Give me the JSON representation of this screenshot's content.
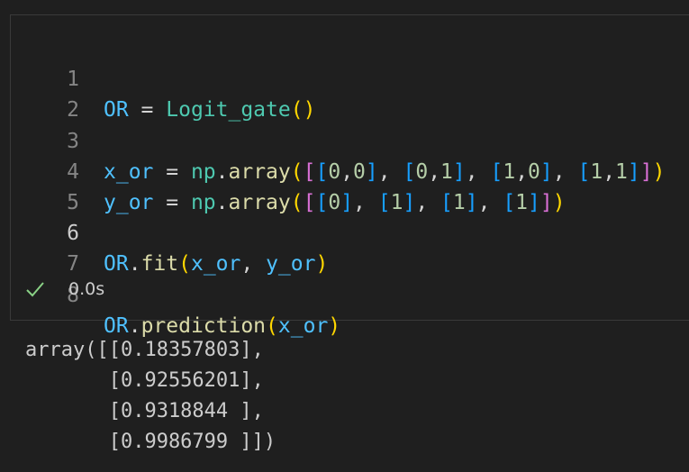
{
  "cell": {
    "lines": [
      {
        "number": "1",
        "tokens": [
          "OR",
          " = ",
          "Logit_gate",
          "(",
          ")"
        ]
      },
      {
        "number": "2",
        "tokens": []
      },
      {
        "number": "3",
        "tokens": [
          "x_or",
          " = ",
          "np",
          ".",
          "array",
          "(",
          "[",
          "[",
          "0",
          ",",
          "0",
          "]",
          ", ",
          "[",
          "0",
          ",",
          "1",
          "]",
          ", ",
          "[",
          "1",
          ",",
          "0",
          "]",
          ", ",
          "[",
          "1",
          ",",
          "1",
          "]",
          "]",
          ")"
        ]
      },
      {
        "number": "4",
        "tokens": [
          "y_or",
          " = ",
          "np",
          ".",
          "array",
          "(",
          "[",
          "[",
          "0",
          "]",
          ", ",
          "[",
          "1",
          "]",
          ", ",
          "[",
          "1",
          "]",
          ", ",
          "[",
          "1",
          "]",
          "]",
          ")"
        ]
      },
      {
        "number": "5",
        "tokens": []
      },
      {
        "number": "6",
        "tokens": [
          "OR",
          ".",
          "fit",
          "(",
          "x_or",
          ", ",
          "y_or",
          ")"
        ]
      },
      {
        "number": "7",
        "tokens": []
      },
      {
        "number": "8",
        "tokens": [
          "OR",
          ".",
          "prediction",
          "(",
          "x_or",
          ")"
        ]
      }
    ],
    "active_line": "6",
    "execution_time": "0.0s",
    "status_icon": "check-icon"
  },
  "output": {
    "lines": [
      "array([[0.18357803],",
      "       [0.92556201],",
      "       [0.9318844 ],",
      "       [0.9986799 ]])"
    ]
  },
  "colors": {
    "background": "#1f1f1f",
    "variable": "#4fc1ff",
    "function": "#dcdcaa",
    "class": "#4ec9b0",
    "number": "#b5cea8",
    "bracket_level_1": "#ffd700",
    "bracket_level_2": "#da70d6",
    "bracket_level_3": "#179fff",
    "check": "#89d185"
  }
}
